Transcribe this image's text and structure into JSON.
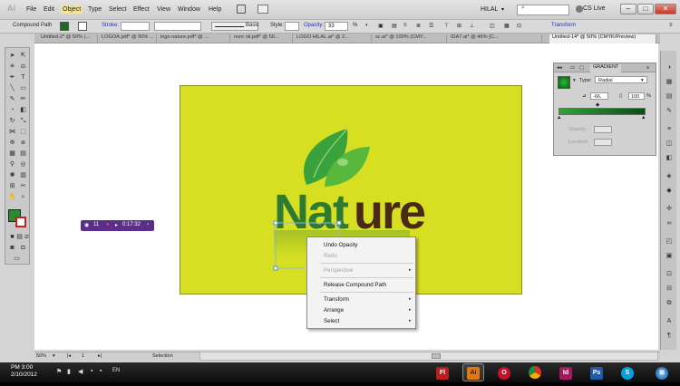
{
  "menubar": {
    "logo": "Ai",
    "items": [
      "File",
      "Edit",
      "Object",
      "Type",
      "Select",
      "Effect",
      "View",
      "Window",
      "Help"
    ],
    "workspace": "HILAL",
    "cs_live": "CS Live"
  },
  "control_bar": {
    "selection_type": "Compound Path",
    "stroke_label": "Stroke:",
    "brush_label": "Basic",
    "style_label": "Style:",
    "opacity_label": "Opacity:",
    "opacity_value": "33",
    "opacity_unit": "%",
    "transform_label": "Transform"
  },
  "tabs": [
    "Untitled-2* @ 50% (...",
    "LOGOA.pdf* @ 50% ...",
    "logo nature.pdf* @ ...",
    "nonr oil.pdf* @ 50...",
    "LOGO HILAL.ai* @ 2...",
    "sc.ai* @ 100% (CMY...",
    "IDA7.ai* @ 46% (C...",
    "Untitled-14* @ 50% (CMYK/Preview)"
  ],
  "artwork": {
    "word_dark_green": "Nat",
    "word_brown": "ure"
  },
  "recorder": {
    "time_a": "11",
    "time_b": "0:17:32"
  },
  "context_menu": {
    "items": [
      {
        "label": "Undo Opacity",
        "enabled": true,
        "submenu": false
      },
      {
        "label": "Redo",
        "enabled": false,
        "submenu": false
      },
      {
        "label": "Perspective",
        "enabled": false,
        "submenu": true
      },
      {
        "label": "Release Compound Path",
        "enabled": true,
        "submenu": false
      },
      {
        "label": "Transform",
        "enabled": true,
        "submenu": true
      },
      {
        "label": "Arrange",
        "enabled": true,
        "submenu": true
      },
      {
        "label": "Select",
        "enabled": true,
        "submenu": true
      }
    ]
  },
  "gradient_panel": {
    "tab_label": "GRADIENT",
    "type_label": "Type:",
    "type_value": "Radial",
    "angle_value": "-66.",
    "aspect_value": "100",
    "aspect_unit": "%",
    "opacity_label": "Opacity:",
    "location_label": "Location:",
    "colors": {
      "start": "#2fa33a",
      "end": "#0b4d12"
    }
  },
  "status_bar": {
    "zoom": "50%",
    "page": "1",
    "mode": "Selection"
  },
  "taskbar": {
    "time": "PM 3:00",
    "date": "2/10/2012",
    "language": "EN",
    "apps": [
      {
        "name": "Fl",
        "color": "#b81e1e"
      },
      {
        "name": "Ai",
        "color": "#e07a10"
      },
      {
        "name": "Opera",
        "color": "#c8102e"
      },
      {
        "name": "Chrome",
        "color": "#e8b400"
      },
      {
        "name": "Id",
        "color": "#a3195b"
      },
      {
        "name": "Ps",
        "color": "#1e5aa8"
      },
      {
        "name": "Skype",
        "color": "#00a2e0"
      },
      {
        "name": "Explorer",
        "color": "#3d6fb5"
      }
    ]
  },
  "colors": {
    "artboard": "#d7df23",
    "dark_green": "#2f7a32",
    "brown": "#4a2a14",
    "leaf": "#3aa23d"
  }
}
